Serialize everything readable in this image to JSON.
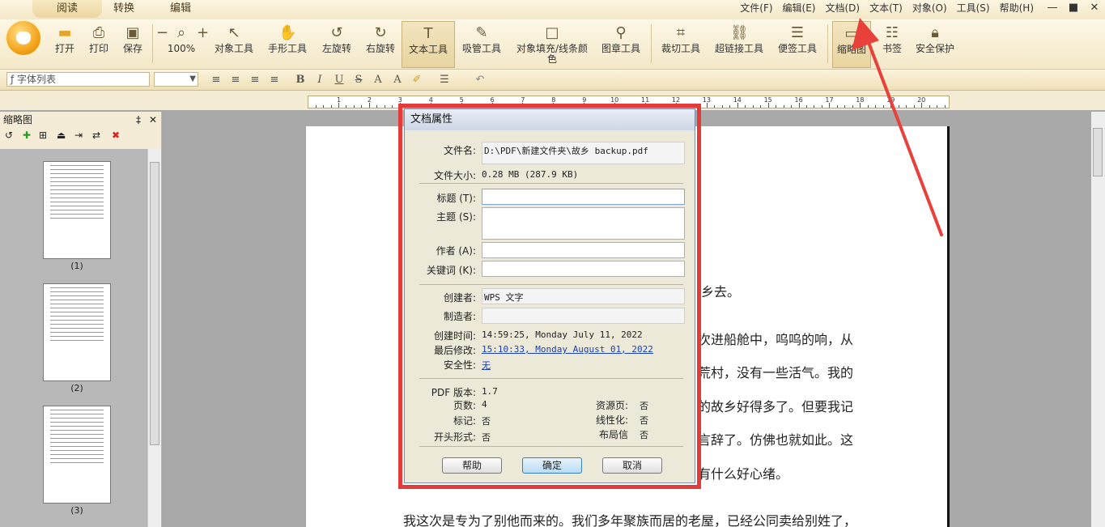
{
  "tabs": [
    "阅读",
    "转换",
    "编辑"
  ],
  "menu": [
    "文件(F)",
    "编辑(E)",
    "文档(D)",
    "文本(T)",
    "对象(O)",
    "工具(S)",
    "帮助(H)"
  ],
  "window_controls": [
    "—",
    "■",
    "✕"
  ],
  "toolbar": {
    "open": "打开",
    "print": "打印",
    "save": "保存",
    "zoom": "100%",
    "zoom_minus": "−",
    "zoom_plus": "+",
    "object_tool": "对象工具",
    "hand_tool": "手形工具",
    "rotate_left": "左旋转",
    "rotate_right": "右旋转",
    "text_tool": "文本工具",
    "eyedropper": "吸管工具",
    "fill_line_color_1": "对象填充/线条颜",
    "fill_line_color_2": "色",
    "stamp_tool": "图章工具",
    "crop_tool": "裁切工具",
    "hyperlink_tool": "超链接工具",
    "note_tool": "便签工具",
    "thumbnail": "缩略图",
    "bookmark": "书签",
    "security": "安全保护"
  },
  "format_bar": {
    "font_list": "字体列表",
    "bold": "B",
    "italic": "I",
    "underline": "U",
    "strike": "S",
    "superscript": "A",
    "subscript": "A"
  },
  "ruler_numbers": [
    "1",
    "2",
    "3",
    "4",
    "5",
    "6",
    "7",
    "8",
    "9",
    "10",
    "11",
    "12",
    "13",
    "14",
    "15",
    "16",
    "17",
    "18",
    "19",
    "20"
  ],
  "panel": {
    "title": "缩略图",
    "pin": "‡",
    "close": "✕",
    "thumb_labels": [
      "(1)",
      "(2)",
      "(3)"
    ]
  },
  "document_lines": [
    "乡去。",
    "次进船舱中，呜呜的响，从",
    "荒村，没有一些活气。我的",
    "的故乡好得多了。但要我记",
    "言辞了。仿佛也就如此。这",
    "有什么好心绪。",
    "我这次是专为了别他而来的。我们多年聚族而居的老屋，已经公同卖给别姓了，"
  ],
  "dialog": {
    "title": "文档属性",
    "filename_label": "文件名:",
    "filename": "D:\\PDF\\新建文件夹\\故乡 backup.pdf",
    "filesize_label": "文件大小:",
    "filesize": "0.28 MB (287.9 KB)",
    "title_label": "标题 (T):",
    "subject_label": "主题 (S):",
    "author_label": "作者 (A):",
    "keywords_label": "关键词 (K):",
    "creator_label": "创建者:",
    "creator": "WPS 文字",
    "producer_label": "制造者:",
    "created_label": "创建时间:",
    "created": "14:59:25, Monday July 11, 2022",
    "modified_label": "最后修改:",
    "modified": "15:10:33, Monday August 01, 2022",
    "security_label": "安全性:",
    "security": "无",
    "pdf_version_label": "PDF 版本:",
    "pdf_version": "1.7",
    "pages_label": "页数:",
    "pages": "4",
    "resources_label": "资源页:",
    "resources": "否",
    "tagged_label": "标记:",
    "tagged": "否",
    "linearized_label": "线性化:",
    "linearized": "否",
    "header_label": "开头形式:",
    "header": "否",
    "layout_label": "布局信",
    "layout": "否",
    "help_button": "帮助",
    "ok_button": "确定",
    "cancel_button": "取消"
  },
  "colors": {
    "highlight_red": "#e33a3a",
    "link_blue": "#1a3fb0"
  }
}
